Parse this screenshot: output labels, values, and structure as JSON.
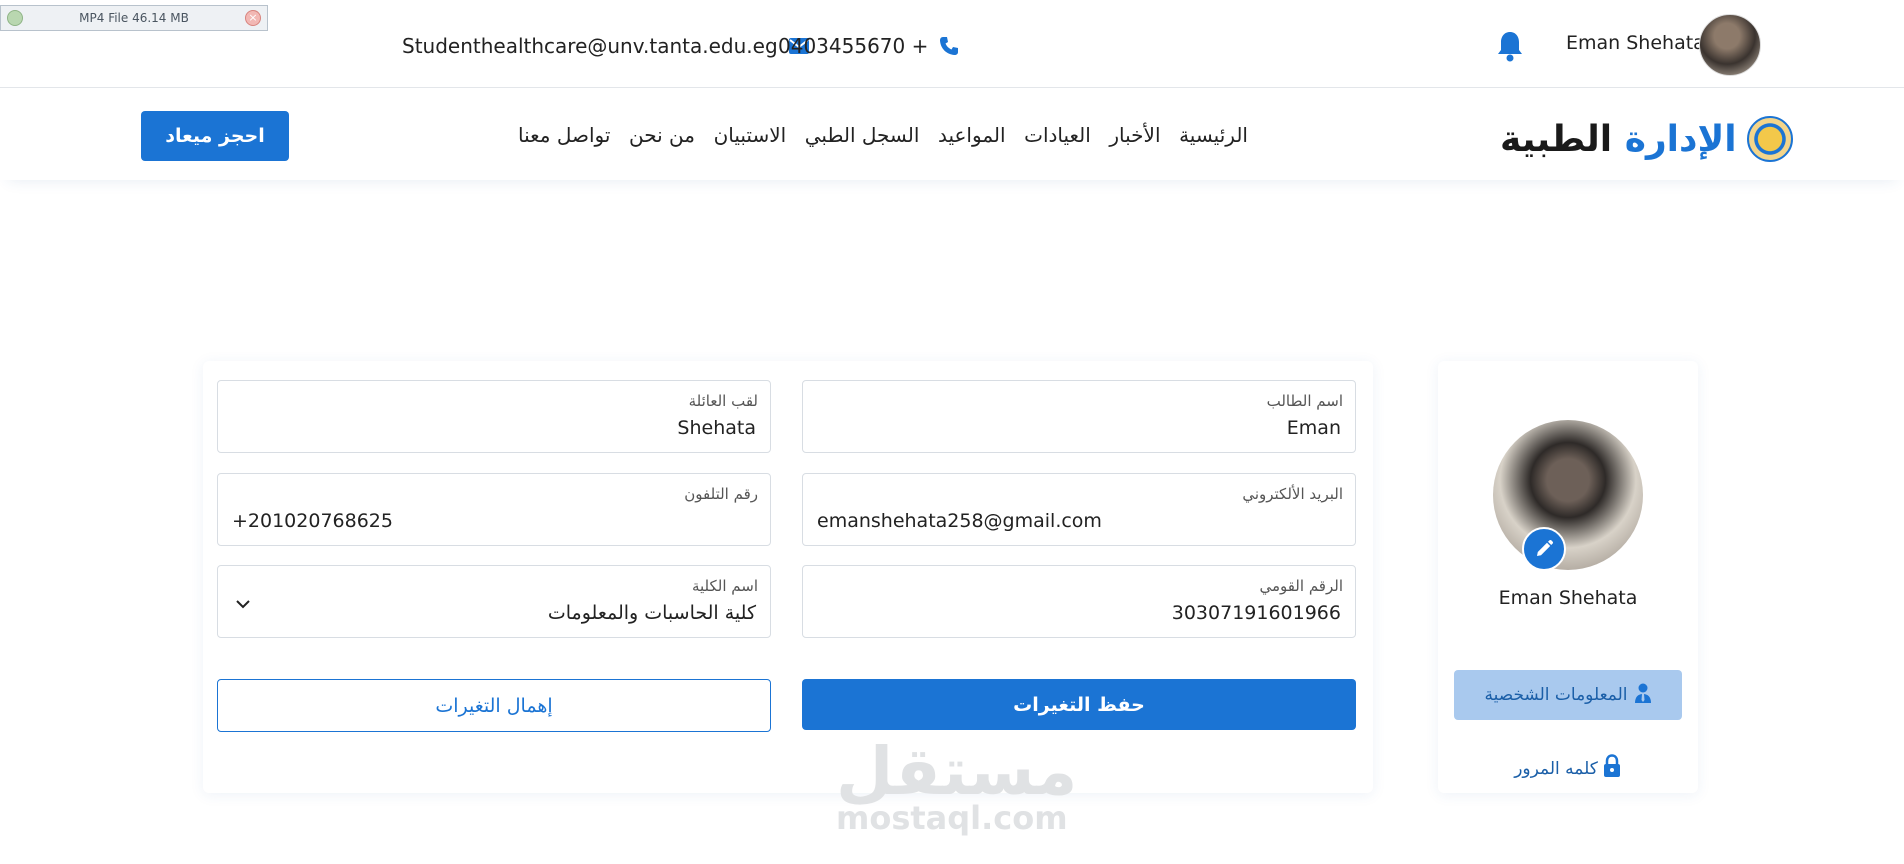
{
  "download_chip": {
    "label": "MP4 File 46.14 MB"
  },
  "topbar": {
    "email": "Studenthealthcare@unv.tanta.edu.eg",
    "phone": "0403455670 +",
    "user_name": "Eman Shehata"
  },
  "nav": {
    "logo_prefix": "الإدارة",
    "logo_suffix": "الطبية",
    "items": [
      "الرئيسية",
      "الأخبار",
      "العيادات",
      "المواعيد",
      "السجل الطبي",
      "الاستبيان",
      "من نحن",
      "تواصل معنا"
    ],
    "book_button": "احجز ميعاد"
  },
  "form": {
    "first_name": {
      "label": "اسم الطالب",
      "value": "Eman"
    },
    "last_name": {
      "label": "لقب العائلة",
      "value": "Shehata"
    },
    "email": {
      "label": "البريد الألكتروني",
      "value": "emanshehata258@gmail.com"
    },
    "phone": {
      "label": "رقم التلفون",
      "value": "+201020768625"
    },
    "national_id": {
      "label": "الرقم القومي",
      "value": "30307191601966"
    },
    "faculty": {
      "label": "اسم الكلية",
      "value": "كلية الحاسبات والمعلومات"
    },
    "save_button": "حفظ التغيرات",
    "cancel_button": "إهمال التغيرات"
  },
  "profile": {
    "name": "Eman Shehata",
    "tab_personal_info": "المعلومات الشخصية",
    "tab_password": "كلمه المرور"
  },
  "watermark": {
    "arabic": "مستقل",
    "latin": "mostaql.com"
  },
  "colors": {
    "primary": "#1b74d4",
    "primary_light": "#a9c9ee"
  }
}
